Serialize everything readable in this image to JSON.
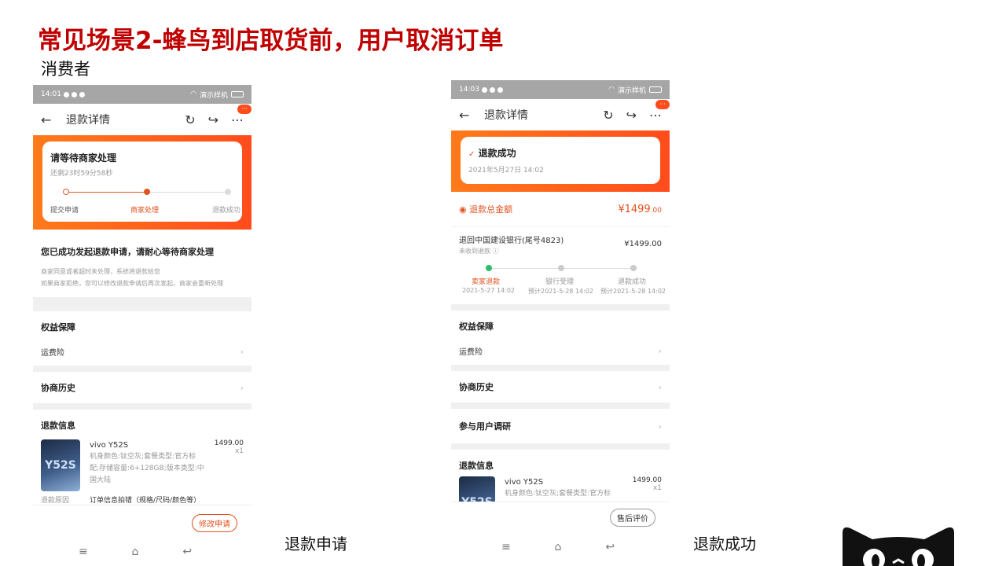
{
  "slide": {
    "title": "常见场景2-蜂鸟到店取货前，用户取消订单",
    "section_label": "消费者",
    "caption_left": "退款申请",
    "caption_right": "退款成功"
  },
  "colors": {
    "accent": "#ff4c1c",
    "title_red": "#c00000"
  },
  "phone_left": {
    "status": {
      "time": "14:01",
      "carrier": "演示样机"
    },
    "nav": {
      "title": "退款详情",
      "badge": "···"
    },
    "card": {
      "title": "请等待商家处理",
      "countdown": "还剩23时59分58秒"
    },
    "steps": [
      "提交申请",
      "商家处理",
      "退款成功"
    ],
    "notice": {
      "title": "您已成功发起退款申请，请耐心等待商家处理",
      "line1": "商家同意或者超时未处理，系统将退款给您",
      "line2": "如果商家拒绝，您可以修改退款申请后再次发起，商家会重新处理"
    },
    "protect_title": "权益保障",
    "shipping_ins": "运费险",
    "history": "协商历史",
    "refund_info": "退款信息",
    "product": {
      "name": "vivo Y52S",
      "desc": "机身颜色:钛空灰;套餐类型:官方标配;存储容量:6+128GB;版本类型:中国大陆",
      "price": "1499.00",
      "qty": "x1",
      "thumb_text": "Y52S"
    },
    "reason_label": "退款原因",
    "reason_value": "订单信息拍错（规格/尺码/颜色等）",
    "button": "修改申请"
  },
  "phone_right": {
    "status": {
      "time": "14:03",
      "carrier": "演示样机"
    },
    "nav": {
      "title": "退款详情",
      "badge": "···"
    },
    "card": {
      "title": "退款成功",
      "date": "2021年5月27日 14:02"
    },
    "total_label": "退款总金额",
    "total_value": "¥1499",
    "total_cents": ".00",
    "bank_line": "退回中国建设银行(尾号4823)",
    "bank_amount": "¥1499.00",
    "not_received": "未收到退款",
    "steps": [
      {
        "label": "卖家退款",
        "time": "2021-5-27 14:02"
      },
      {
        "label": "银行受理",
        "time": "预计2021-5-28 14:02"
      },
      {
        "label": "退款成功",
        "time": "预计2021-5-28 14:02"
      }
    ],
    "protect_title": "权益保障",
    "shipping_ins": "运费险",
    "history": "协商历史",
    "survey": "参与用户调研",
    "refund_info": "退款信息",
    "product": {
      "name": "vivo Y52S",
      "desc": "机身颜色:钛空灰;套餐类型:官方标",
      "price": "1499.00",
      "qty": "x1",
      "thumb_text": "Y52S"
    },
    "button": "售后评价"
  }
}
